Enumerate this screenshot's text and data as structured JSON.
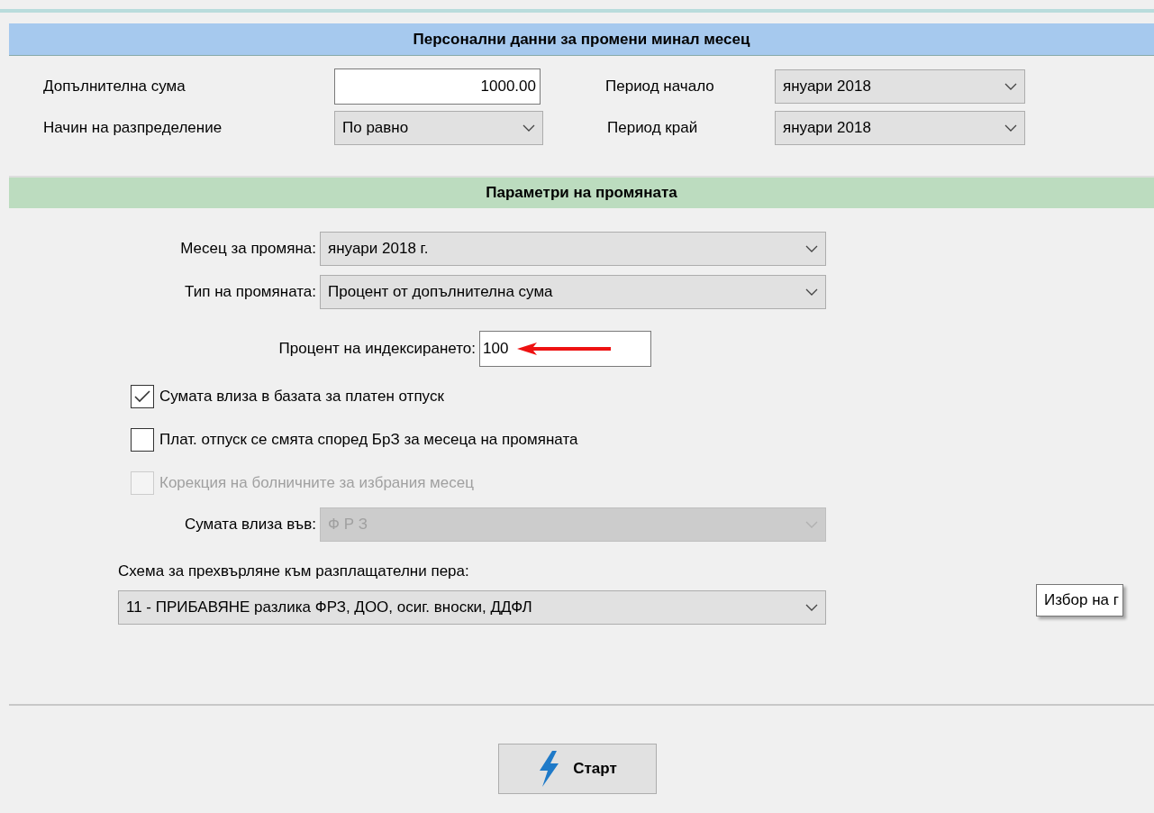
{
  "section_1": {
    "title": "Персонални данни за промени минал месец",
    "fields": [
      {
        "label": "Допълнителна сума",
        "kind": "input",
        "value": "1000.00"
      },
      {
        "label": "Период начало",
        "kind": "select",
        "value": "януари 2018"
      },
      {
        "label": "Начин на разпределение",
        "kind": "select",
        "value": "По равно"
      },
      {
        "label": "Период край",
        "kind": "select",
        "value": "януари 2018"
      }
    ]
  },
  "section_2": {
    "title": "Параметри на промяната",
    "month": {
      "label": "Месец за промяна:",
      "value": "януари 2018 г."
    },
    "change_type": {
      "label": "Тип на промяната:",
      "value": "Процент от допълнителна сума"
    },
    "percent": {
      "label": "Процент на индексирането:",
      "value": "100"
    },
    "checkboxes": [
      {
        "label": "Сумата влиза в базата за платен отпуск",
        "checked": true,
        "disabled": false
      },
      {
        "label": "Плат. отпуск се смята според БрЗ за месеца на промяната",
        "checked": false,
        "disabled": false
      },
      {
        "label": "Корекция на болничните за избрания месец",
        "checked": false,
        "disabled": true
      }
    ],
    "included_in": {
      "label": "Сумата влиза във:",
      "value": "Ф Р З",
      "disabled": true
    },
    "scheme": {
      "label": "Схема за прехвърляне към разплащателни пера:",
      "value": "11 - ПРИБАВЯНЕ разлика ФРЗ, ДОО, осиг. вноски, ДДФЛ"
    },
    "tooltip": "Избор на г"
  },
  "start_button": "Старт"
}
